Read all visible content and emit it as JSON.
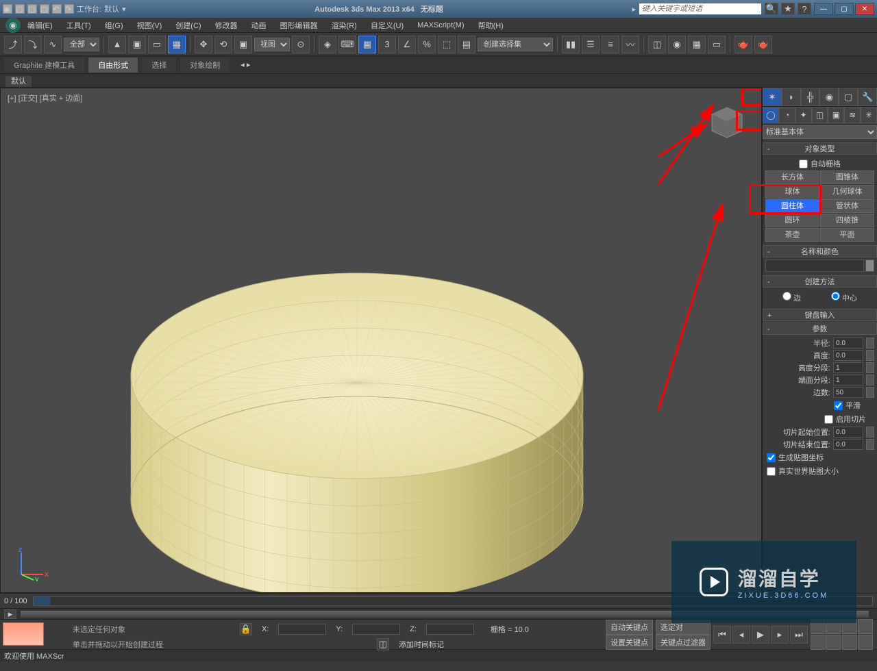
{
  "title": {
    "app": "Autodesk 3ds Max  2013 x64",
    "doc": "无标题",
    "workspace_label": "工作台:",
    "workspace_value": "默认",
    "search_placeholder": "键入关键字或短语"
  },
  "menu": [
    "编辑(E)",
    "工具(T)",
    "组(G)",
    "视图(V)",
    "创建(C)",
    "修改器",
    "动画",
    "图形编辑器",
    "渲染(R)",
    "自定义(U)",
    "MAXScript(M)",
    "帮助(H)"
  ],
  "toolbar": {
    "filter": "全部",
    "ref": "视图",
    "selset": "创建选择集"
  },
  "ribbon": {
    "tabs": [
      "Graphite 建模工具",
      "自由形式",
      "选择",
      "对象绘制"
    ],
    "active": 1,
    "sub": "默认"
  },
  "viewport": {
    "label": "[+] [正交] [真实 + 边面]"
  },
  "cmd": {
    "category": "标准基本体",
    "rollouts": {
      "obj_type": "对象类型",
      "auto_grid": "自动栅格",
      "name_color": "名称和颜色",
      "create_method": "创建方法",
      "edge": "边",
      "center": "中心",
      "kb_input": "键盘输入",
      "params": "参数"
    },
    "buttons": [
      [
        "长方体",
        "圆锥体"
      ],
      [
        "球体",
        "几何球体"
      ],
      [
        "圆柱体",
        "管状体"
      ],
      [
        "圆环",
        "四棱锥"
      ],
      [
        "茶壶",
        "平面"
      ]
    ],
    "selected": "圆柱体",
    "params": {
      "radius_l": "半径:",
      "radius_v": "0.0",
      "height_l": "高度:",
      "height_v": "0.0",
      "hseg_l": "高度分段:",
      "hseg_v": "1",
      "cseg_l": "端面分段:",
      "cseg_v": "1",
      "sides_l": "边数:",
      "sides_v": "50",
      "smooth": "平滑",
      "slice_on": "启用切片",
      "slice_from_l": "切片起始位置:",
      "slice_from_v": "0.0",
      "slice_to_l": "切片结束位置:",
      "slice_to_v": "0.0",
      "genmap": "生成贴图坐标",
      "realworld": "真实世界贴图大小"
    }
  },
  "timeline": {
    "frame": "0 / 100"
  },
  "status": {
    "line1": "未选定任何对象",
    "line2": "单击并拖动以开始创建过程",
    "x": "X:",
    "y": "Y:",
    "z": "Z:",
    "grid": "栅格 = 10.0",
    "autokey": "自动关键点",
    "setkey": "设置关键点",
    "keyfilter": "关键点过滤器",
    "seldisp": "选定对",
    "addtime": "添加时间标记"
  },
  "welcome": {
    "label": "欢迎使用  MAXScr"
  },
  "watermark": {
    "brand": "溜溜自学",
    "url": "ZIXUE.3D66.COM"
  }
}
